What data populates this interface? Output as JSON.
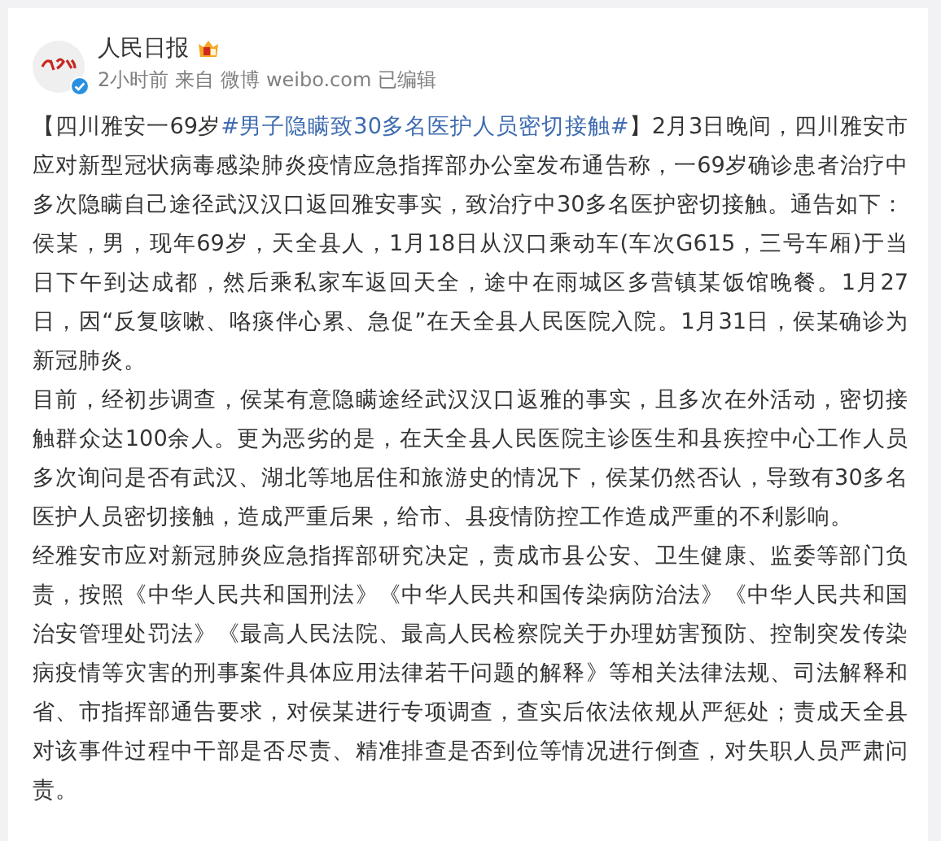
{
  "post": {
    "author": "人民日报",
    "time": "2小时前",
    "from_label": "来自",
    "source": "微博 weibo.com",
    "edited": "已编辑",
    "paragraphs": [
      {
        "segments": [
          {
            "kind": "text",
            "text": "【四川雅安一69岁"
          },
          {
            "kind": "link",
            "text": "#男子隐瞒致30多名医护人员密切接触#"
          },
          {
            "kind": "text",
            "text": "】2月3日晚间，四川雅安市应对新型冠状病毒感染肺炎疫情应急指挥部办公室发布通告称，一69岁确诊患者治疗中多次隐瞒自己途径武汉汉口返回雅安事实，致治疗中30多名医护密切接触。通告如下："
          }
        ]
      },
      {
        "segments": [
          {
            "kind": "text",
            "text": "侯某，男，现年69岁，天全县人，1月18日从汉口乘动车(车次G615，三号车厢)于当日下午到达成都，然后乘私家车返回天全，途中在雨城区多营镇某饭馆晚餐。1月27日，因“反复咳嗽、咯痰伴心累、急促”在天全县人民医院入院。1月31日，侯某确诊为新冠肺炎。"
          }
        ]
      },
      {
        "segments": [
          {
            "kind": "text",
            "text": "目前，经初步调查，侯某有意隐瞒途经武汉汉口返雅的事实，且多次在外活动，密切接触群众达100余人。更为恶劣的是，在天全县人民医院主诊医生和县疾控中心工作人员多次询问是否有武汉、湖北等地居住和旅游史的情况下，侯某仍然否认，导致有30多名医护人员密切接触，造成严重后果，给市、县疫情防控工作造成严重的不利影响。"
          }
        ]
      },
      {
        "segments": [
          {
            "kind": "text",
            "text": "经雅安市应对新冠肺炎应急指挥部研究决定，责成市县公安、卫生健康、监委等部门负责，按照《中华人民共和国刑法》《中华人民共和国传染病防治法》《中华人民共和国治安管理处罚法》《最高人民法院、最高人民检察院关于办理妨害预防、控制突发传染病疫情等灾害的刑事案件具体应用法律若干问题的解释》等相关法律法规、司法解释和省、市指挥部通告要求，对侯某进行专项调查，查实后依法依规从严惩处；责成天全县对该事件过程中干部是否尽责、精准排查是否到位等情况进行倒查，对失职人员严肃问责。"
          }
        ]
      }
    ]
  }
}
